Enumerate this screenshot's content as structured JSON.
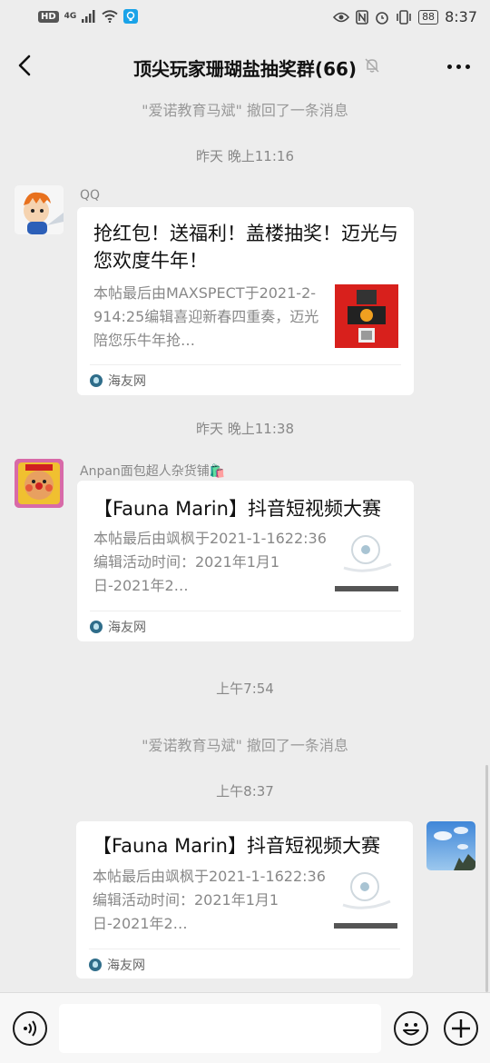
{
  "status_bar": {
    "hd": "HD",
    "network": "4G",
    "battery": "88",
    "time": "8:37"
  },
  "header": {
    "title": "顶尖玩家珊瑚盐抽奖群(66)"
  },
  "messages": [
    {
      "type": "notice",
      "text": "\"爱诺教育马斌\" 撤回了一条消息"
    },
    {
      "type": "time",
      "text": "昨天 晚上11:16"
    },
    {
      "type": "link",
      "sender": "QQ",
      "title": "抢红包！送福利！盖楼抽奖！迈光与您欢度牛年！",
      "desc": "本帖最后由MAXSPECT于2021-2-914:25编辑喜迎新春四重奏，迈光陪您乐牛年抢…",
      "source": "海友网"
    },
    {
      "type": "time",
      "text": "昨天 晚上11:38"
    },
    {
      "type": "link",
      "sender": "Anpan面包超人杂货铺🛍️",
      "title": "【Fauna Marin】抖音短视频大赛",
      "desc": "本帖最后由飒枫于2021-1-1622:36编辑活动时间：2021年1月1日-2021年2…",
      "source": "海友网"
    },
    {
      "type": "time",
      "text": "上午7:54"
    },
    {
      "type": "notice",
      "text": "\"爱诺教育马斌\" 撤回了一条消息"
    },
    {
      "type": "time",
      "text": "上午8:37"
    },
    {
      "type": "link",
      "sender": "",
      "title": "【Fauna Marin】抖音短视频大赛",
      "desc": "本帖最后由飒枫于2021-1-1622:36编辑活动时间：2021年1月1日-2021年2…",
      "source": "海友网"
    }
  ],
  "colors": {
    "background": "#ededed",
    "card": "#ffffff",
    "notice_text": "#999999"
  }
}
